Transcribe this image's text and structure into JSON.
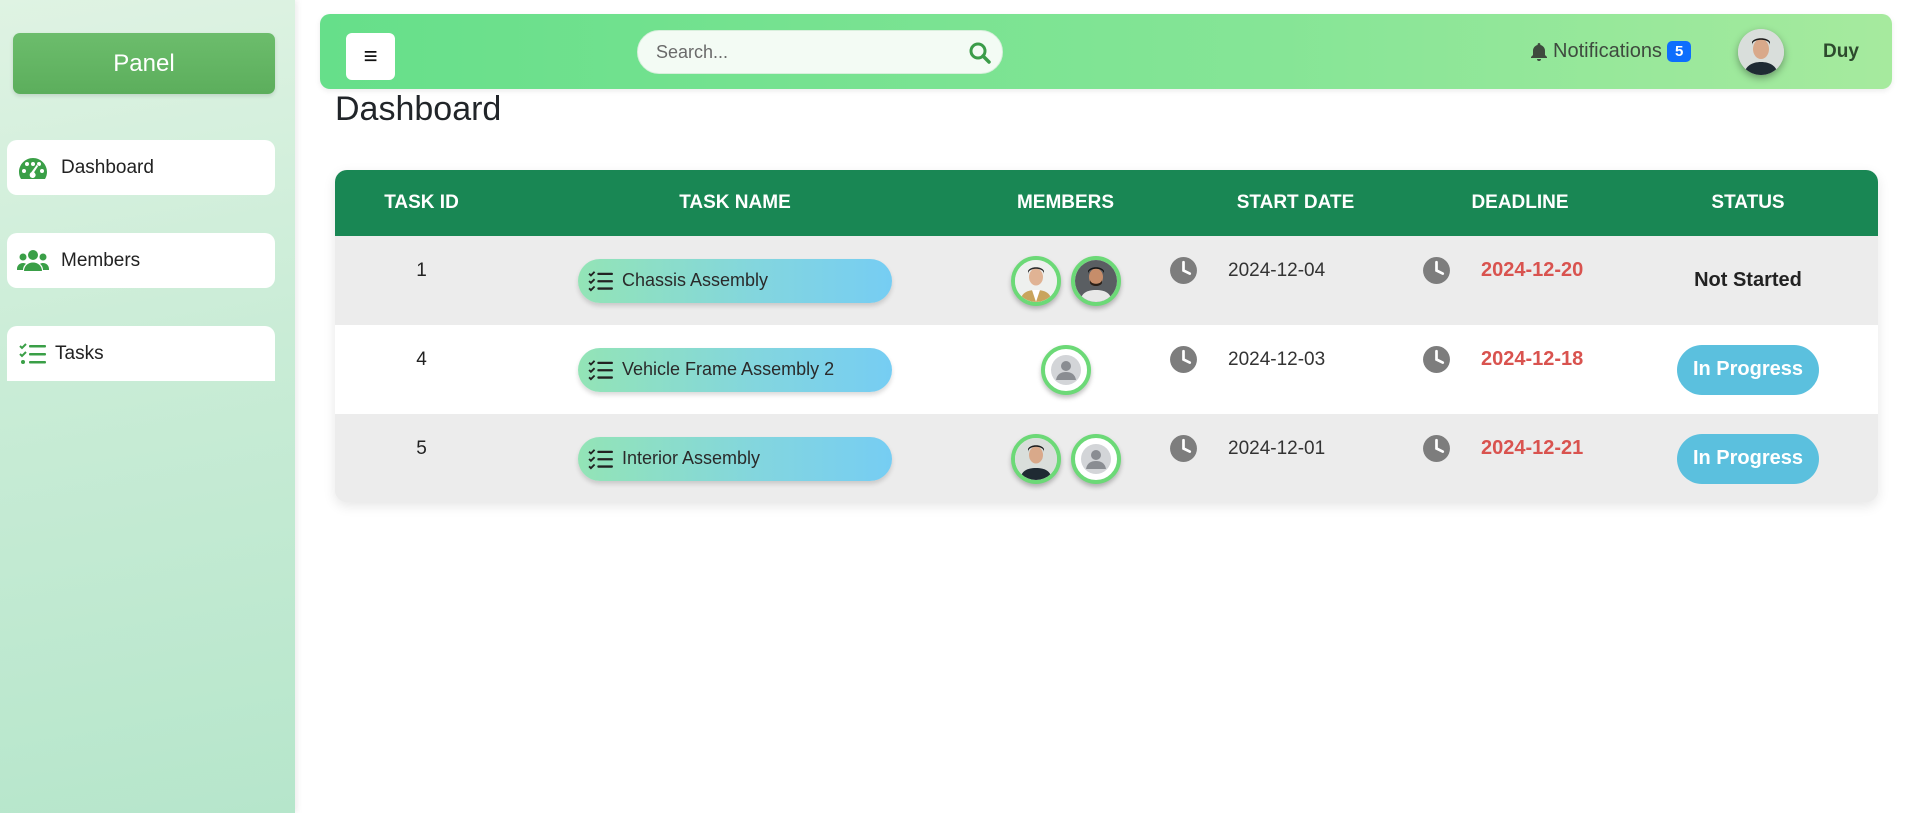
{
  "sidebar": {
    "panel_label": "Panel",
    "items": [
      {
        "label": "Dashboard",
        "icon": "gauge-icon"
      },
      {
        "label": "Members",
        "icon": "users-icon"
      },
      {
        "label": "Tasks",
        "icon": "list-check-icon"
      }
    ]
  },
  "header": {
    "menu_icon": "≡",
    "search_placeholder": "Search...",
    "notifications_label": "Notifications",
    "notifications_count": "5",
    "user_name": "Duy"
  },
  "main": {
    "title": "Dashboard",
    "table": {
      "columns": [
        "TASK ID",
        "TASK NAME",
        "MEMBERS",
        "START DATE",
        "DEADLINE",
        "STATUS"
      ],
      "rows": [
        {
          "id": "1",
          "name": "Chassis Assembly",
          "members": [
            "photo",
            "photo"
          ],
          "start_date": "2024-12-04",
          "deadline": "2024-12-20",
          "status": "Not Started",
          "status_style": "text"
        },
        {
          "id": "4",
          "name": "Vehicle Frame Assembly 2",
          "members": [
            "default"
          ],
          "start_date": "2024-12-03",
          "deadline": "2024-12-18",
          "status": "In Progress",
          "status_style": "badge"
        },
        {
          "id": "5",
          "name": "Interior Assembly",
          "members": [
            "photo",
            "default"
          ],
          "start_date": "2024-12-01",
          "deadline": "2024-12-21",
          "status": "In Progress",
          "status_style": "badge"
        }
      ]
    }
  },
  "colors": {
    "header_green": "#198754",
    "accent_green": "#5cb85c",
    "deadline_red": "#d9534f",
    "status_blue": "#5bc0de",
    "badge_blue": "#0d6efd"
  }
}
